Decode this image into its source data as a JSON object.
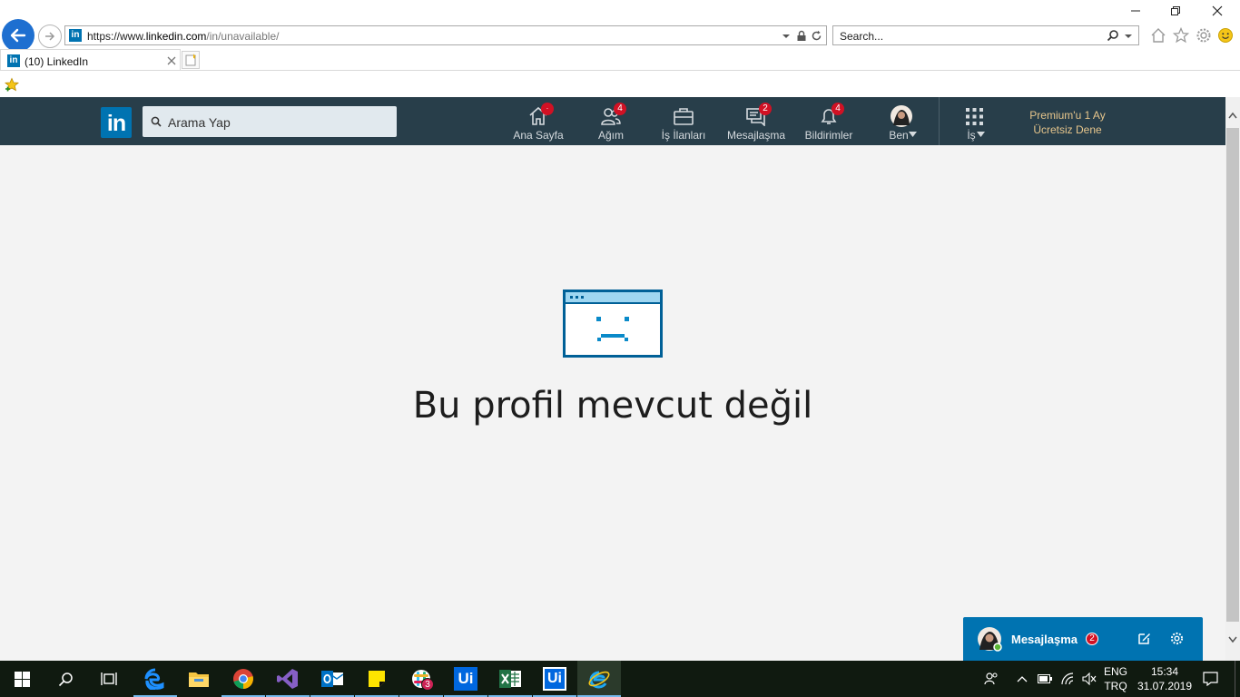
{
  "browser": {
    "url_prefix": "https://www.",
    "url_domain": "linkedin.com",
    "url_path": "/in/unavailable/",
    "search_placeholder": "Search...",
    "tab_title": "(10) LinkedIn"
  },
  "linkedin": {
    "logo_text": "in",
    "search_placeholder": "Arama Yap",
    "nav": [
      {
        "label": "Ana Sayfa",
        "badge": "·"
      },
      {
        "label": "Ağım",
        "badge": "4"
      },
      {
        "label": "İş İlanları",
        "badge": ""
      },
      {
        "label": "Mesajlaşma",
        "badge": "2"
      },
      {
        "label": "Bildirimler",
        "badge": "4"
      },
      {
        "label": "Ben"
      },
      {
        "label": "İş"
      }
    ],
    "premium_line1": "Premium'u 1 Ay",
    "premium_line2": "Ücretsiz Dene",
    "accent": "#0073b1",
    "nav_bg": "#283e4a"
  },
  "main": {
    "message": "Bu profil mevcut değil"
  },
  "messaging": {
    "label": "Mesajlaşma",
    "badge": "2"
  },
  "taskbar": {
    "apps": [
      "windows-start",
      "search",
      "task-view",
      "edge",
      "file-explorer",
      "chrome",
      "visual-studio",
      "outlook",
      "sticky-notes",
      "slack",
      "uipath-studio",
      "excel",
      "uipath",
      "internet-explorer"
    ],
    "slack_badge": "3",
    "lang_line1": "ENG",
    "lang_line2": "TRQ",
    "time": "15:34",
    "date": "31.07.2019"
  }
}
